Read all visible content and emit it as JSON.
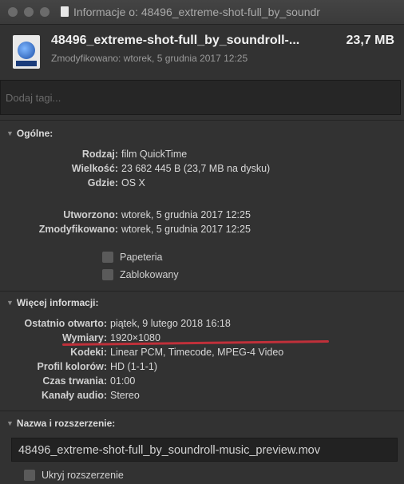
{
  "window": {
    "title": "Informacje o: 48496_extreme-shot-full_by_soundr"
  },
  "file": {
    "name": "48496_extreme-shot-full_by_soundroll-...",
    "size": "23,7 MB",
    "modified": "Zmodyfikowano: wtorek, 5 grudnia 2017 12:25"
  },
  "tags": {
    "placeholder": "Dodaj tagi..."
  },
  "general": {
    "header": "Ogólne:",
    "rows": [
      {
        "label": "Rodzaj:",
        "value": "film QuickTime"
      },
      {
        "label": "Wielkość:",
        "value": "23 682 445 B (23,7 MB na dysku)"
      },
      {
        "label": "Gdzie:",
        "value": "OS X"
      },
      {
        "label": "Utworzono:",
        "value": "wtorek, 5 grudnia 2017 12:25"
      },
      {
        "label": "Zmodyfikowano:",
        "value": "wtorek, 5 grudnia 2017 12:25"
      }
    ],
    "checkboxes": [
      {
        "label": "Papeteria",
        "checked": false
      },
      {
        "label": "Zablokowany",
        "checked": false
      }
    ]
  },
  "more_info": {
    "header": "Więcej informacji:",
    "rows": [
      {
        "label": "Ostatnio otwarto:",
        "value": "piątek, 9 lutego 2018 16:18"
      },
      {
        "label": "Wymiary:",
        "value": "1920×1080"
      },
      {
        "label": "Kodeki:",
        "value": "Linear PCM, Timecode, MPEG-4 Video"
      },
      {
        "label": "Profil kolorów:",
        "value": "HD (1-1-1)"
      },
      {
        "label": "Czas trwania:",
        "value": "01:00"
      },
      {
        "label": "Kanały audio:",
        "value": "Stereo"
      }
    ]
  },
  "name_ext": {
    "header": "Nazwa i rozszerzenie:",
    "filename": "48496_extreme-shot-full_by_soundroll-music_preview.mov",
    "hide_extension_label": "Ukryj rozszerzenie"
  },
  "colors": {
    "background": "#323232",
    "highlight_underline": "#c0303a"
  }
}
